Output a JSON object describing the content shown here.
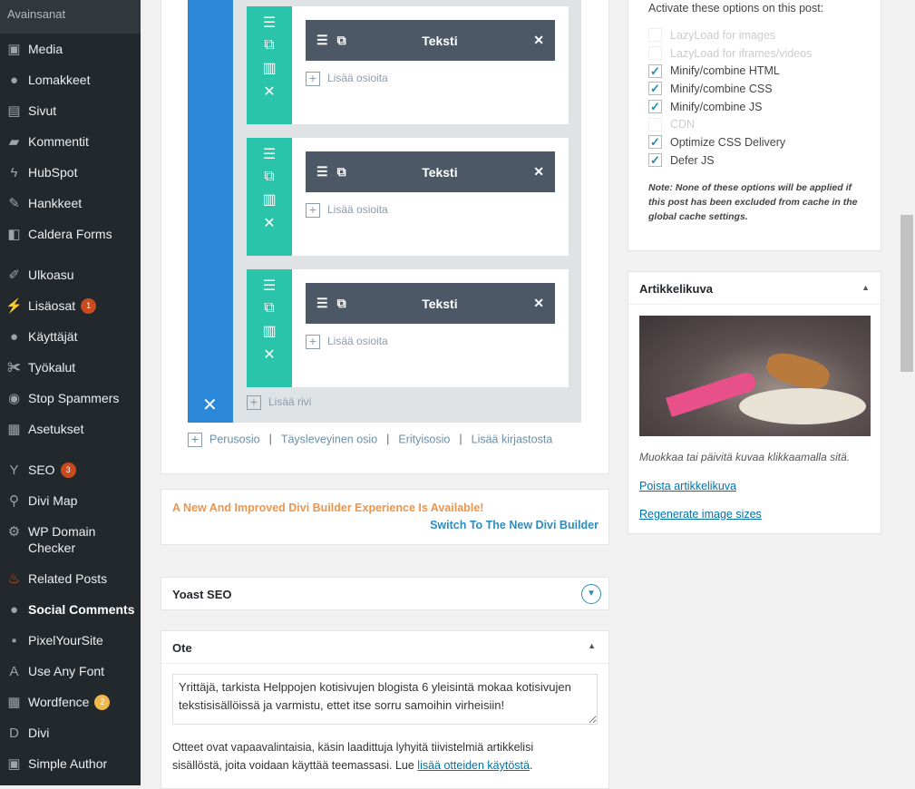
{
  "sidebar": {
    "top": "Avainsanat",
    "items": [
      {
        "label": "Media",
        "icon": "media-icon"
      },
      {
        "label": "Lomakkeet",
        "icon": "forms-icon"
      },
      {
        "label": "Sivut",
        "icon": "pages-icon"
      },
      {
        "label": "Kommentit",
        "icon": "comments-icon"
      },
      {
        "label": "HubSpot",
        "icon": "hubspot-icon"
      },
      {
        "label": "Hankkeet",
        "icon": "pin-icon"
      },
      {
        "label": "Caldera Forms",
        "icon": "caldera-icon"
      },
      {
        "label": "Ulkoasu",
        "icon": "brush-icon"
      },
      {
        "label": "Lisäosat",
        "icon": "plugin-icon",
        "badge": "1"
      },
      {
        "label": "Käyttäjät",
        "icon": "user-icon"
      },
      {
        "label": "Työkalut",
        "icon": "wrench-icon"
      },
      {
        "label": "Stop Spammers",
        "icon": "stop-icon"
      },
      {
        "label": "Asetukset",
        "icon": "settings-icon"
      },
      {
        "label": "SEO",
        "icon": "yoast-icon",
        "badge": "3"
      },
      {
        "label": "Divi Map",
        "icon": "map-pin-icon"
      },
      {
        "label": "WP Domain Checker",
        "icon": "gear-icon"
      },
      {
        "label": "Related Posts",
        "icon": "flame-icon"
      },
      {
        "label": "Social Comments",
        "icon": "social-icon"
      },
      {
        "label": "PixelYourSite",
        "icon": "pixel-icon"
      },
      {
        "label": "Use Any Font",
        "icon": "font-icon"
      },
      {
        "label": "Wordfence",
        "icon": "wordfence-icon",
        "badge": "2"
      },
      {
        "label": "Divi",
        "icon": "divi-icon"
      },
      {
        "label": "Simple Author",
        "icon": "author-icon"
      }
    ]
  },
  "builder": {
    "module_label": "Teksti",
    "add_module": "Lisää osioita",
    "add_row": "Lisää rivi",
    "links": [
      "Perusosio",
      "Täysleveyinen osio",
      "Erityisosio",
      "Lisää kirjastosta"
    ],
    "colors": {
      "section": "#2b87da",
      "row": "#29c4a9",
      "module": "#4c5866"
    }
  },
  "notice": {
    "text": "A New And Improved Divi Builder Experience Is Available!",
    "link": "Switch To The New Divi Builder"
  },
  "yoast": {
    "title": "Yoast SEO"
  },
  "excerpt": {
    "title": "Ote",
    "value": "Yrittäjä, tarkista Helppojen kotisivujen blogista 6 yleisintä mokaa kotisivujen tekstisisällöissä ja varmistu, ettet itse sorru samoihin virheisiin!",
    "help": "Otteet ovat vapaavalintaisia, käsin laadittuja lyhyitä tiivistelmiä artikkelisi sisällöstä, joita voidaan käyttää teemassasi. Lue ",
    "help_link": "lisää otteiden käytöstä",
    "help_end": "."
  },
  "cache": {
    "intro": "Activate these options on this post:",
    "options": [
      {
        "label": "LazyLoad for images",
        "checked": false,
        "disabled": true
      },
      {
        "label": "LazyLoad for iframes/videos",
        "checked": false,
        "disabled": true
      },
      {
        "label": "Minify/combine HTML",
        "checked": true
      },
      {
        "label": "Minify/combine CSS",
        "checked": true
      },
      {
        "label": "Minify/combine JS",
        "checked": true
      },
      {
        "label": "CDN",
        "checked": false,
        "disabled": true
      },
      {
        "label": "Optimize CSS Delivery",
        "checked": true
      },
      {
        "label": "Defer JS",
        "checked": true
      }
    ],
    "note": "Note: None of these options will be applied if this post has been excluded from cache in the global cache settings."
  },
  "featured": {
    "title": "Artikkelikuva",
    "caption": "Muokkaa tai päivitä kuvaa klikkaamalla sitä.",
    "remove": "Poista artikkelikuva",
    "regenerate": "Regenerate image sizes"
  }
}
